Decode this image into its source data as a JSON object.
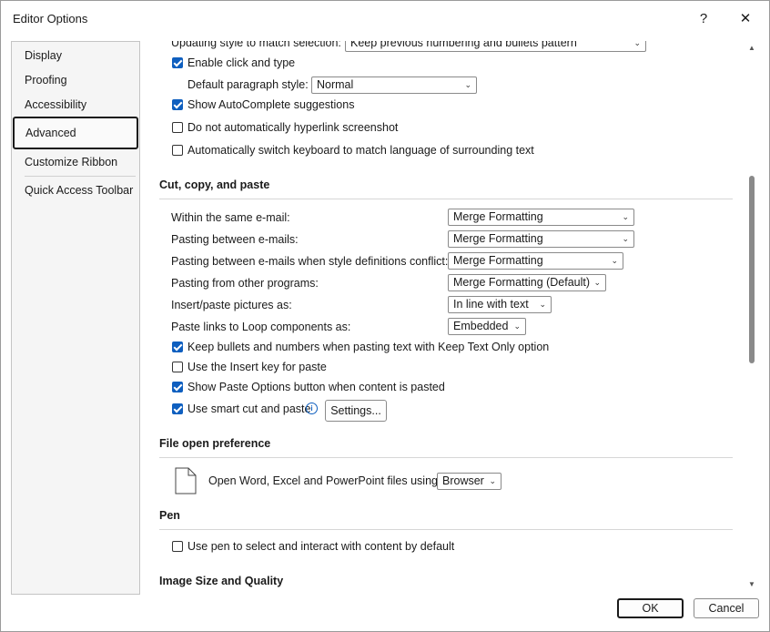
{
  "window": {
    "title": "Editor Options",
    "help_label": "?",
    "close_label": "✕"
  },
  "nav": {
    "items": [
      {
        "label": "Display"
      },
      {
        "label": "Proofing"
      },
      {
        "label": "Accessibility"
      },
      {
        "label": "Advanced"
      },
      {
        "label": "Customize Ribbon"
      },
      {
        "label": "Quick Access Toolbar"
      }
    ],
    "active": "Advanced"
  },
  "editing": {
    "updating_style_label": "Updating style to match selection:",
    "updating_style_value": "Keep previous numbering and bullets pattern",
    "enable_click_type": {
      "label": "Enable click and type",
      "checked": true
    },
    "default_paragraph_label": "Default paragraph style:",
    "default_paragraph_value": "Normal",
    "autocomplete": {
      "label": "Show AutoComplete suggestions",
      "checked": true
    },
    "no_hyperlink": {
      "label": "Do not automatically hyperlink screenshot",
      "checked": false
    },
    "auto_keyboard": {
      "label": "Automatically switch keyboard to match language of surrounding text",
      "checked": false
    }
  },
  "cut_copy_paste": {
    "heading": "Cut, copy, and paste",
    "rows": [
      {
        "label": "Within the same e-mail:",
        "value": "Merge Formatting"
      },
      {
        "label": "Pasting between e-mails:",
        "value": "Merge Formatting"
      },
      {
        "label": "Pasting between e-mails when style definitions conflict:",
        "value": "Merge Formatting"
      },
      {
        "label": "Pasting from other programs:",
        "value": "Merge Formatting (Default)"
      },
      {
        "label": "Insert/paste pictures as:",
        "value": "In line with text"
      },
      {
        "label": "Paste links to Loop components as:",
        "value": "Embedded"
      }
    ],
    "keep_bullets": {
      "label": "Keep bullets and numbers when pasting text with Keep Text Only option",
      "checked": true
    },
    "insert_key": {
      "label": "Use the Insert key for paste",
      "checked": false
    },
    "paste_options": {
      "label": "Show Paste Options button when content is pasted",
      "checked": true
    },
    "smart_cut": {
      "label": "Use smart cut and paste",
      "checked": true
    },
    "info_glyph": "i",
    "settings_label": "Settings..."
  },
  "file_open": {
    "heading": "File open preference",
    "label": "Open Word, Excel and PowerPoint files using:",
    "value": "Browser"
  },
  "pen": {
    "heading": "Pen",
    "use_pen": {
      "label": "Use pen to select and interact with content by default",
      "checked": false
    }
  },
  "image": {
    "heading": "Image Size and Quality"
  },
  "footer": {
    "ok_label": "OK",
    "cancel_label": "Cancel"
  },
  "scroll": {
    "up": "▲",
    "down": "▼"
  },
  "chevron": "⌄"
}
